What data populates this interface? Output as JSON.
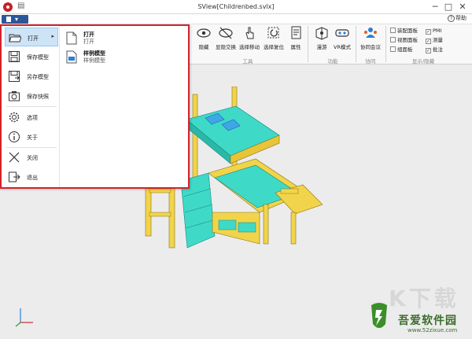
{
  "window": {
    "title": "SView[Childrenbed.svlx]",
    "minimize": "─",
    "maximize": "□",
    "close": "✕"
  },
  "quick_access": {
    "icon": "document-icon",
    "glyph": "▤"
  },
  "ribbon": {
    "file_button": {
      "icon": "file-document-icon",
      "dropdown": "▾"
    },
    "help_label": "帮助",
    "help_glyph": "?",
    "groups": [
      {
        "label": "工具",
        "buttons": [
          {
            "label": "隐藏",
            "icon": "eye-icon"
          },
          {
            "label": "显隐交换",
            "icon": "eye-slash-icon"
          },
          {
            "label": "选择移动",
            "icon": "hand-pointer-icon"
          },
          {
            "label": "选择复位",
            "icon": "reset-select-icon"
          },
          {
            "label": "属性",
            "icon": "properties-icon"
          }
        ]
      },
      {
        "label": "功能",
        "buttons": [
          {
            "label": "漫游",
            "icon": "walkthrough-icon"
          },
          {
            "label": "VR模式",
            "icon": "vr-headset-icon"
          }
        ]
      },
      {
        "label": "协同",
        "buttons": [
          {
            "label": "协同会议",
            "icon": "meeting-people-icon"
          }
        ]
      },
      {
        "label": "显示/隐藏",
        "checkboxes": [
          {
            "label": "装配面板",
            "checked": false
          },
          {
            "label": "视图面板",
            "checked": false
          },
          {
            "label": "组面板",
            "checked": false
          },
          {
            "label": "PMI",
            "checked": true
          },
          {
            "label": "测量",
            "checked": true
          },
          {
            "label": "批注",
            "checked": true
          }
        ],
        "check_glyph": "✓"
      }
    ]
  },
  "file_menu": {
    "items": [
      {
        "label": "打开",
        "icon": "folder-open-icon",
        "active": true,
        "arrow": "▸"
      },
      {
        "label": "保存模型",
        "icon": "save-icon"
      },
      {
        "label": "另存模型",
        "icon": "save-as-icon"
      },
      {
        "label": "保存快照",
        "icon": "camera-icon"
      },
      {
        "label": "选项",
        "icon": "gear-icon"
      },
      {
        "label": "关于",
        "icon": "info-icon"
      },
      {
        "label": "关闭",
        "icon": "close-x-icon"
      },
      {
        "label": "退出",
        "icon": "exit-icon"
      }
    ],
    "submenu": [
      {
        "title": "打开",
        "description": "打开",
        "icon": "blank-document-icon"
      },
      {
        "title": "样例模型",
        "description": "样例模型",
        "icon": "sample-model-icon"
      }
    ]
  },
  "watermark": {
    "name": "吾爱软件园",
    "url": "www.52zixue.com",
    "faint_text": "K下载"
  },
  "colors": {
    "menu_border": "#d2232a",
    "bed_frame": "#f2d44a",
    "bed_mattress": "#3fd9c8",
    "pillow": "#3fa6e8",
    "active_item": "#cde4f7"
  }
}
